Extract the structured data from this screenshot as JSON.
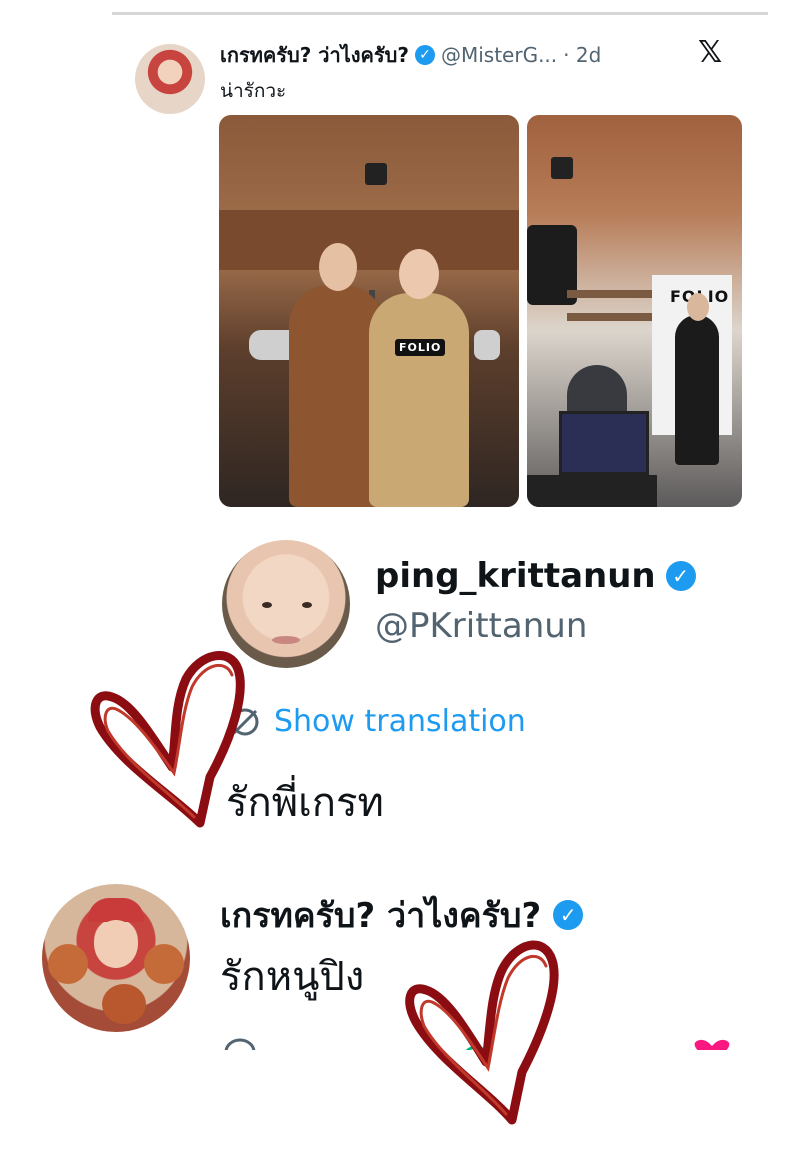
{
  "top_tweet": {
    "author_name": "เกรทครับ? ว่าไงครับ?",
    "verified_mark": "✓",
    "handle": "@MisterG...",
    "time": "· 2d",
    "text": "น่ารักวะ",
    "app_logo": "𝕏",
    "photo_1": {
      "label": "FOLIO"
    },
    "photo_2": {
      "label": "FOLIO"
    }
  },
  "ping_tweet": {
    "author_name": "ping_krittanun",
    "verified_mark": "✓",
    "handle": "@PKrittanun",
    "translate_icon": "globe-icon",
    "translate_label": "Show translation",
    "text": "รักพี่เกรท"
  },
  "reply_tweet": {
    "author_name": "เกรทครับ? ว่าไงครับ?",
    "verified_mark": "✓",
    "text": "รักหนูปิง"
  },
  "colors": {
    "link": "#1d9bf0",
    "muted": "#536471",
    "heart_drawing": "#8b0d12",
    "like": "#f91880"
  }
}
